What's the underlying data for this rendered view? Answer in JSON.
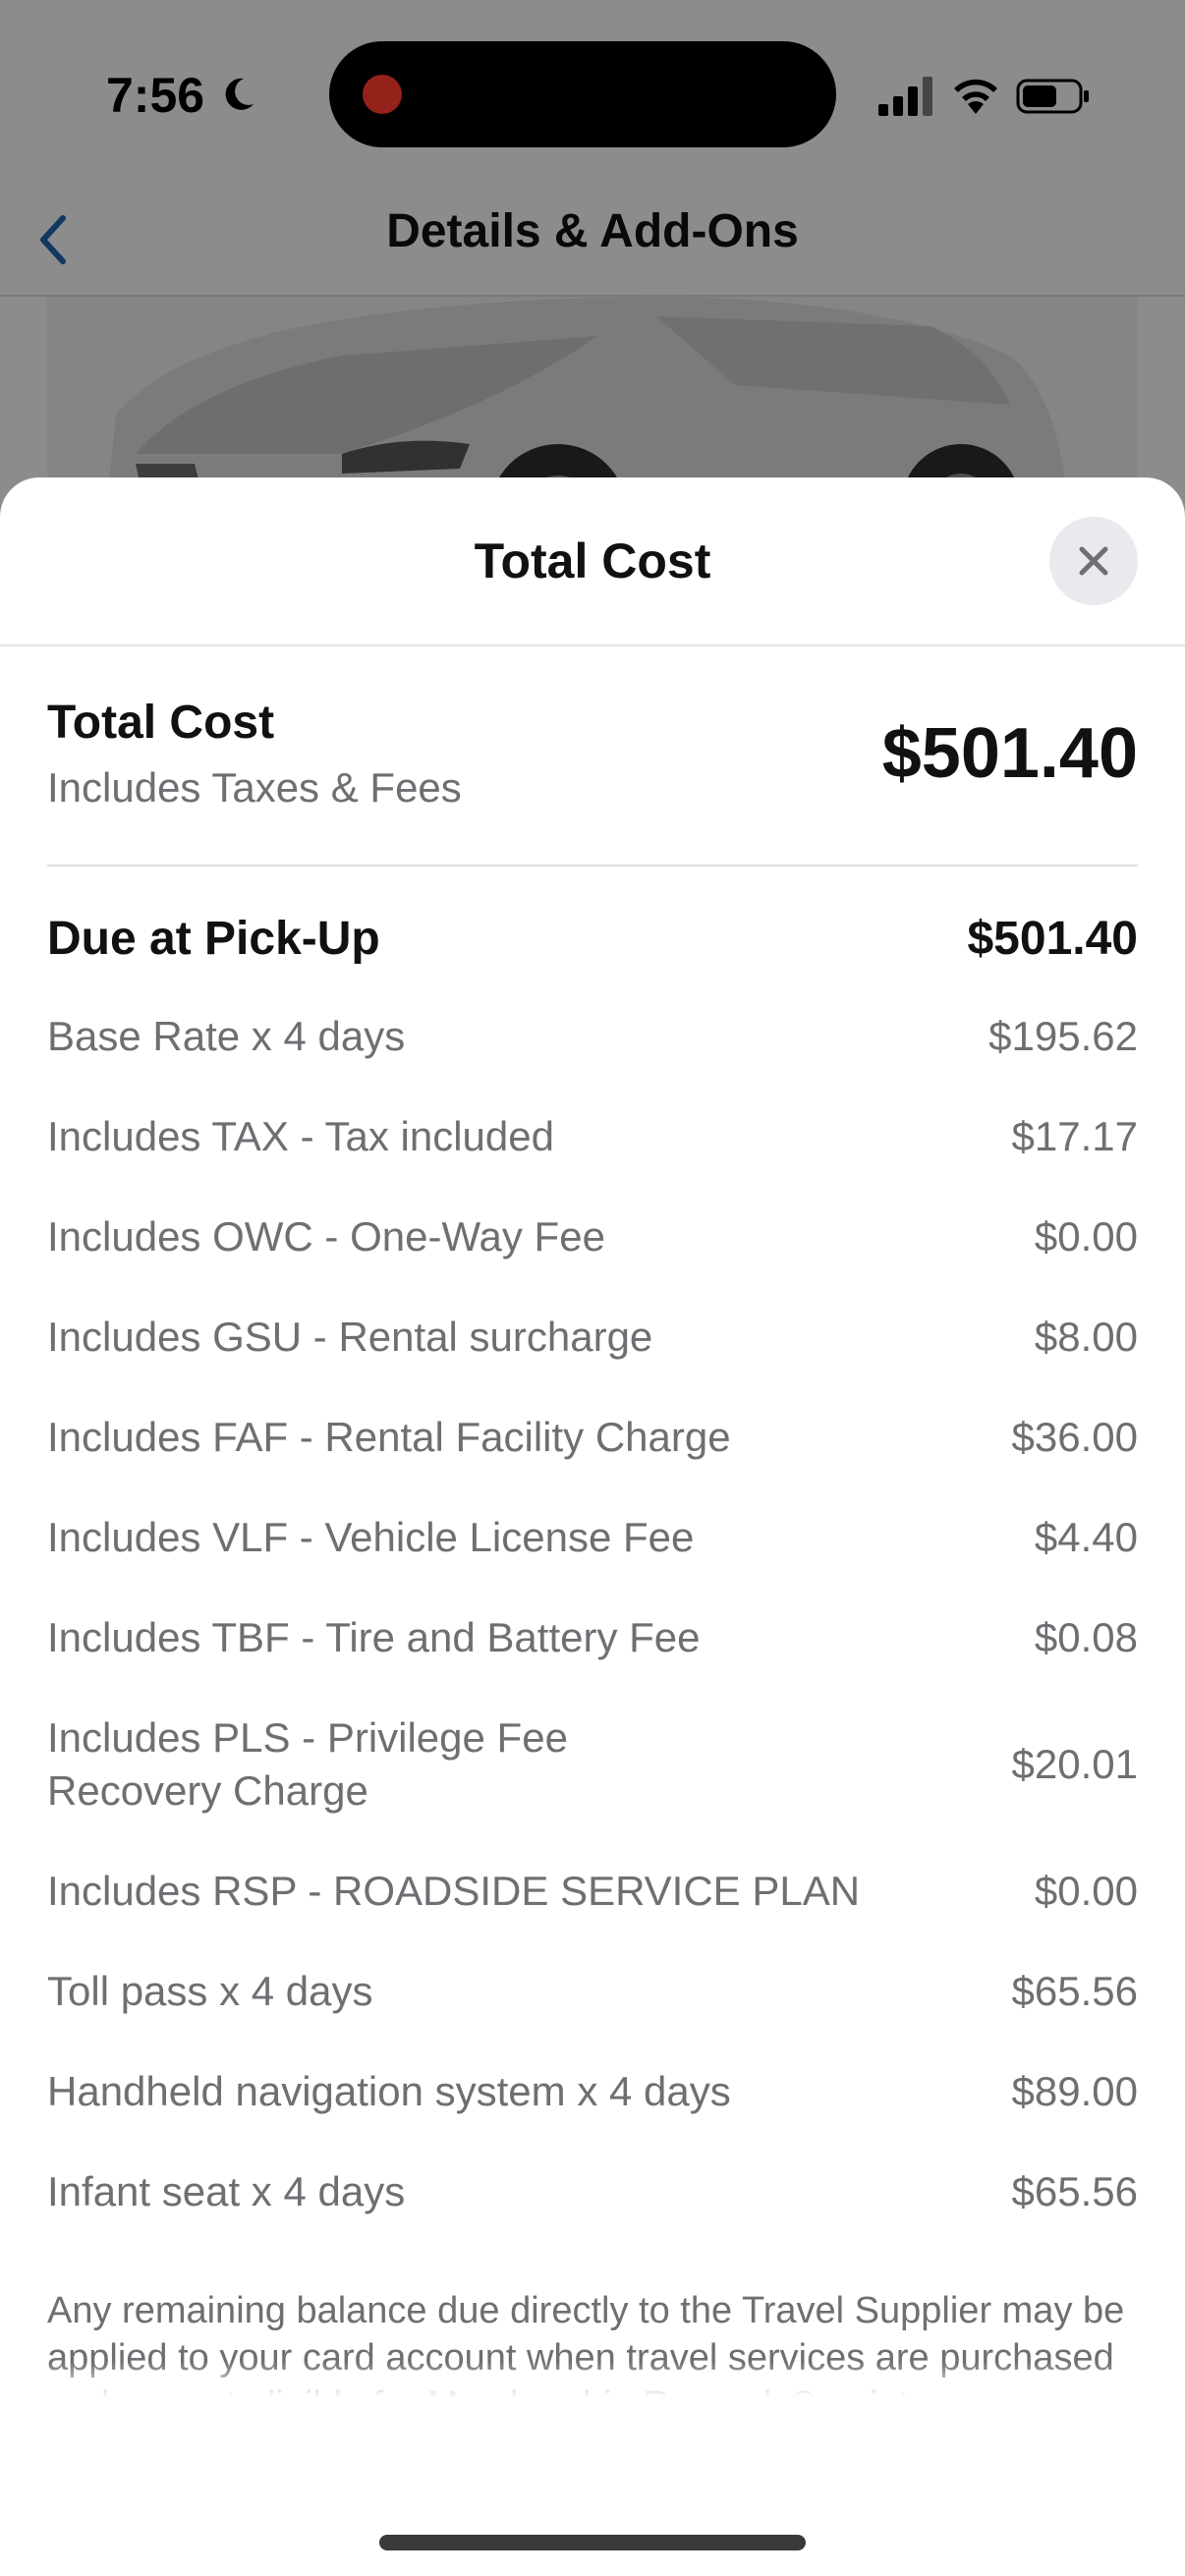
{
  "status_bar": {
    "time": "7:56"
  },
  "nav": {
    "title": "Details & Add-Ons"
  },
  "sheet": {
    "title": "Total Cost",
    "summary": {
      "title": "Total Cost",
      "subtitle": "Includes Taxes & Fees",
      "amount": "$501.40"
    },
    "due": {
      "label": "Due at Pick-Up",
      "amount": "$501.40"
    },
    "line_items": [
      {
        "label": "Base Rate x 4 days",
        "value": "$195.62"
      },
      {
        "label": "Includes TAX - Tax included",
        "value": "$17.17"
      },
      {
        "label": "Includes OWC - One-Way Fee",
        "value": "$0.00"
      },
      {
        "label": "Includes GSU - Rental surcharge",
        "value": "$8.00"
      },
      {
        "label": "Includes FAF - Rental Facility Charge",
        "value": "$36.00"
      },
      {
        "label": "Includes VLF - Vehicle License Fee",
        "value": "$4.40"
      },
      {
        "label": "Includes TBF - Tire and Battery Fee",
        "value": "$0.08"
      },
      {
        "label": "Includes PLS - Privilege Fee Recovery Charge",
        "value": "$20.01"
      },
      {
        "label": "Includes RSP - ROADSIDE SERVICE PLAN",
        "value": "$0.00"
      },
      {
        "label": "Toll pass x 4 days",
        "value": "$65.56"
      },
      {
        "label": "Handheld navigation system x 4 days",
        "value": "$89.00"
      },
      {
        "label": "Infant seat x 4 days",
        "value": "$65.56"
      }
    ],
    "disclaimer": "Any remaining balance due directly to the Travel Supplier may be applied to your card account when travel services are purchased and are not eligible for Membership Rewards® points."
  },
  "colors": {
    "accent": "#1f5fa8",
    "text_primary": "#111111",
    "text_secondary": "#6e6e73",
    "recording_dot": "#ff3b30"
  },
  "icons": {
    "back": "chevron-left-icon",
    "close": "close-icon",
    "moon": "moon-icon",
    "signal": "cellular-signal-icon",
    "wifi": "wifi-icon",
    "battery": "battery-icon"
  }
}
